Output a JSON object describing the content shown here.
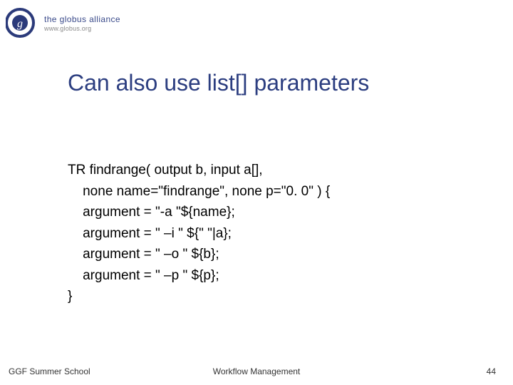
{
  "logo": {
    "org": "the globus alliance",
    "url": "www.globus.org"
  },
  "title": "Can also use list[] parameters",
  "code": {
    "l1": "TR findrange( output b, input a[],",
    "l2": "    none name=\"findrange\", none p=\"0. 0\" ) {",
    "l3": "    argument = \"-a \"${name};",
    "l4": "    argument = \" –i \" ${\" \"|a};",
    "l5": "    argument = \" –o \" ${b};",
    "l6": "    argument = \" –p \" ${p};",
    "l7": "}"
  },
  "footer": {
    "left": "GGF Summer School",
    "center": "Workflow Management",
    "right": "44"
  }
}
